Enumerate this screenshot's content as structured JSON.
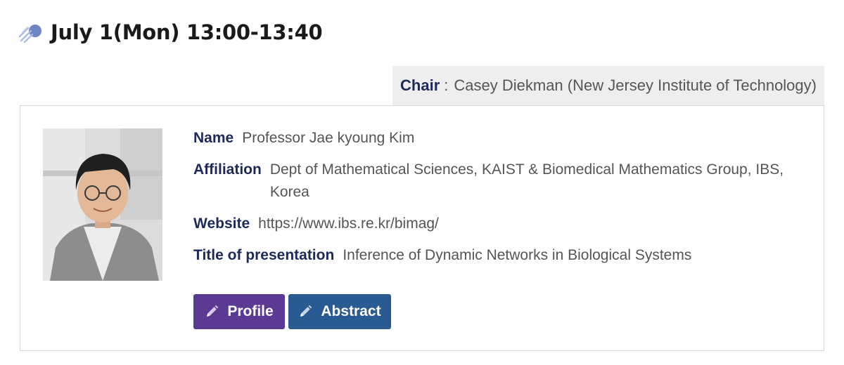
{
  "session": {
    "title": "July 1(Mon) 13:00-13:40",
    "icon": "meteor-icon"
  },
  "chair": {
    "label": "Chair",
    "separator": ":",
    "value": "Casey Diekman (New Jersey Institute of Technology)"
  },
  "speaker": {
    "name_label": "Name",
    "name": "Professor Jae kyoung Kim",
    "affiliation_label": "Affiliation",
    "affiliation": "Dept of Mathematical Sciences, KAIST & Biomedical Mathematics Group, IBS, Korea",
    "website_label": "Website",
    "website": "https://www.ibs.re.kr/bimag/",
    "title_label": "Title of presentation",
    "title": "Inference of Dynamic Networks in Biological Systems"
  },
  "buttons": {
    "profile_label": "Profile",
    "abstract_label": "Abstract",
    "icon": "pencil-icon"
  },
  "colors": {
    "label_navy": "#1c2a5a",
    "profile_button": "#5b3a93",
    "abstract_button": "#295a92",
    "chair_background": "#eeeeee"
  }
}
